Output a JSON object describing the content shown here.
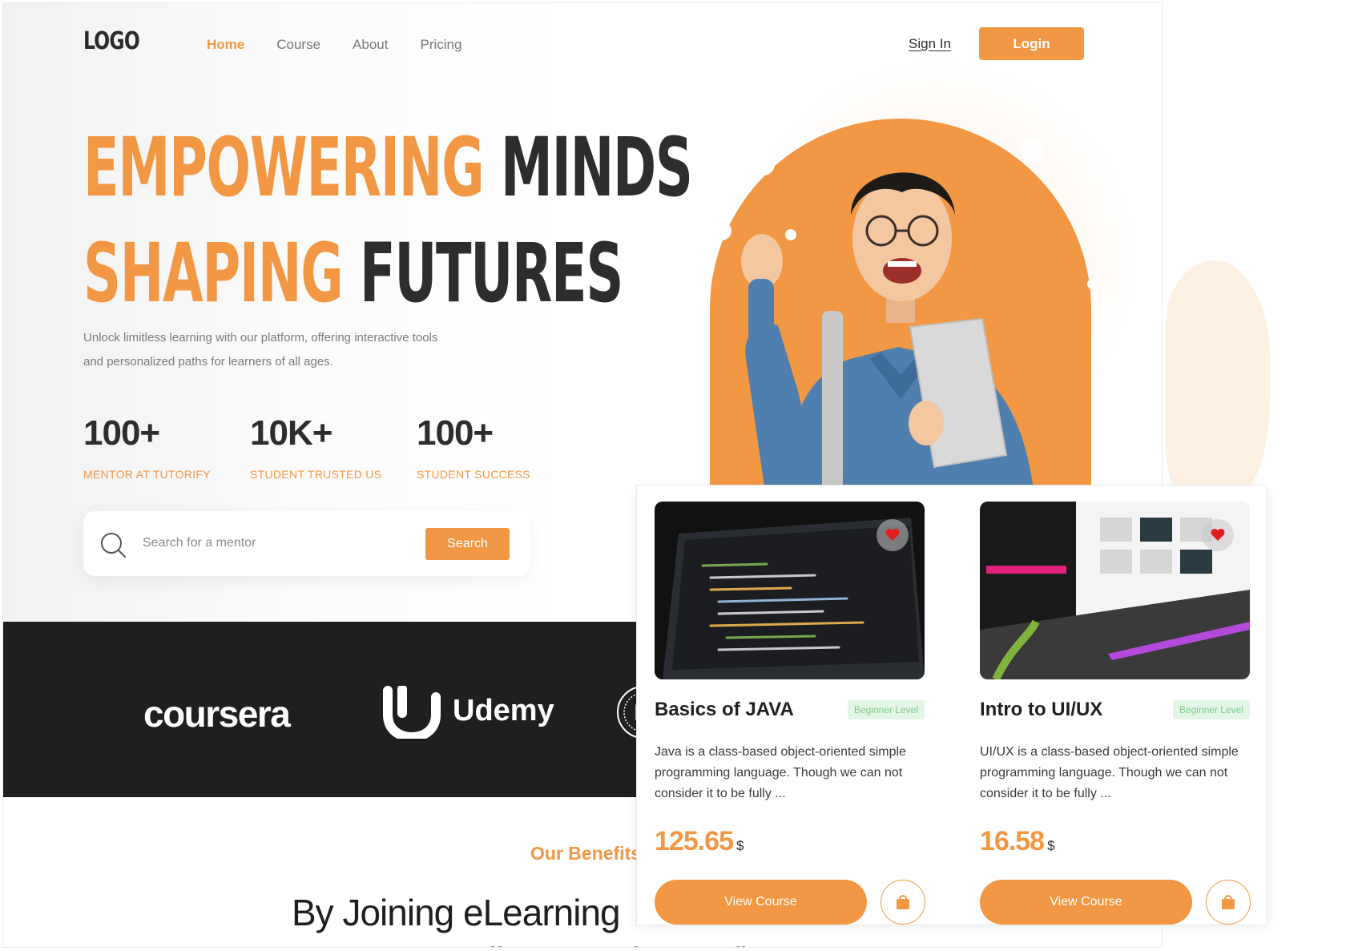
{
  "header": {
    "logo": "LOGO",
    "nav": [
      "Home",
      "Course",
      "About",
      "Pricing"
    ],
    "signin": "Sign In",
    "login": "Login"
  },
  "hero": {
    "line1_orange": "EMPOWERING",
    "line1_dark": "MINDS",
    "line2_orange": "SHAPING",
    "line2_dark": "FUTURES",
    "subtitle": "Unlock limitless learning with our platform, offering interactive tools and personalized paths for learners of all ages.",
    "stats": [
      {
        "value": "100+",
        "label": "MENTOR AT TUTORIFY"
      },
      {
        "value": "10K+",
        "label": "STUDENT TRUSTED US"
      },
      {
        "value": "100+",
        "label": "STUDENT SUCCESS"
      }
    ],
    "search": {
      "placeholder": "Search for a mentor",
      "button": "Search",
      "icon": "search-icon"
    }
  },
  "partners": [
    "coursera",
    "Udemy"
  ],
  "benefits": {
    "tag": "Our Benefits",
    "title_line1": "By Joining eLearning",
    "title_line2": "Can Avail a Lot Of Benefits"
  },
  "courses": [
    {
      "title": "Basics of JAVA",
      "level": "Beginner Level",
      "description": "Java is a class-based object-oriented simple programming language. Though we can not consider it to be fully ...",
      "price": "125.65",
      "currency": "$",
      "cta": "View Course",
      "fav_icon": "heart-icon",
      "cart_icon": "shopping-bag-icon"
    },
    {
      "title": "Intro to UI/UX",
      "level": "Beginner Level",
      "description": "UI/UX is a class-based object-oriented simple programming language. Though we can not consider it to be fully ...",
      "price": "16.58",
      "currency": "$",
      "cta": "View Course",
      "fav_icon": "heart-icon",
      "cart_icon": "shopping-bag-icon"
    }
  ],
  "colors": {
    "accent": "#f29845",
    "dark": "#1f1f1f",
    "level_bg": "#e3f5e5",
    "level_text": "#7ecb8a"
  }
}
